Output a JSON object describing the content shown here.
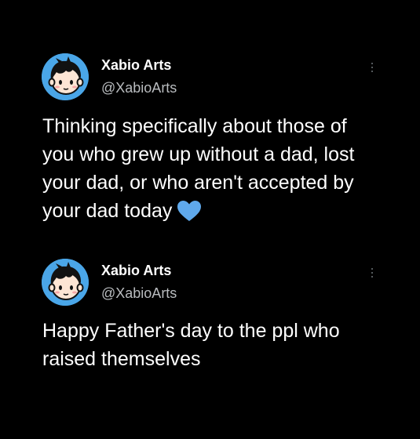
{
  "tweets": [
    {
      "author": {
        "name": "Xabio Arts",
        "handle": "@XabioArts",
        "avatar": "cartoon-boy-avatar"
      },
      "text": "Thinking specifically about those of you who grew up without a dad, lost your dad, or who aren't accepted by your dad today",
      "emoji": "blue-heart-icon",
      "menu_icon": "more-vertical-icon"
    },
    {
      "author": {
        "name": "Xabio Arts",
        "handle": "@XabioArts",
        "avatar": "cartoon-boy-avatar"
      },
      "text": "Happy Father's day to the ppl who raised themselves",
      "menu_icon": "more-vertical-icon"
    }
  ],
  "colors": {
    "background": "#000000",
    "text": "#ffffff",
    "handle": "#b9bcbf",
    "avatar_bg": "#4aa6e8",
    "heart": "#5fa9ec"
  }
}
